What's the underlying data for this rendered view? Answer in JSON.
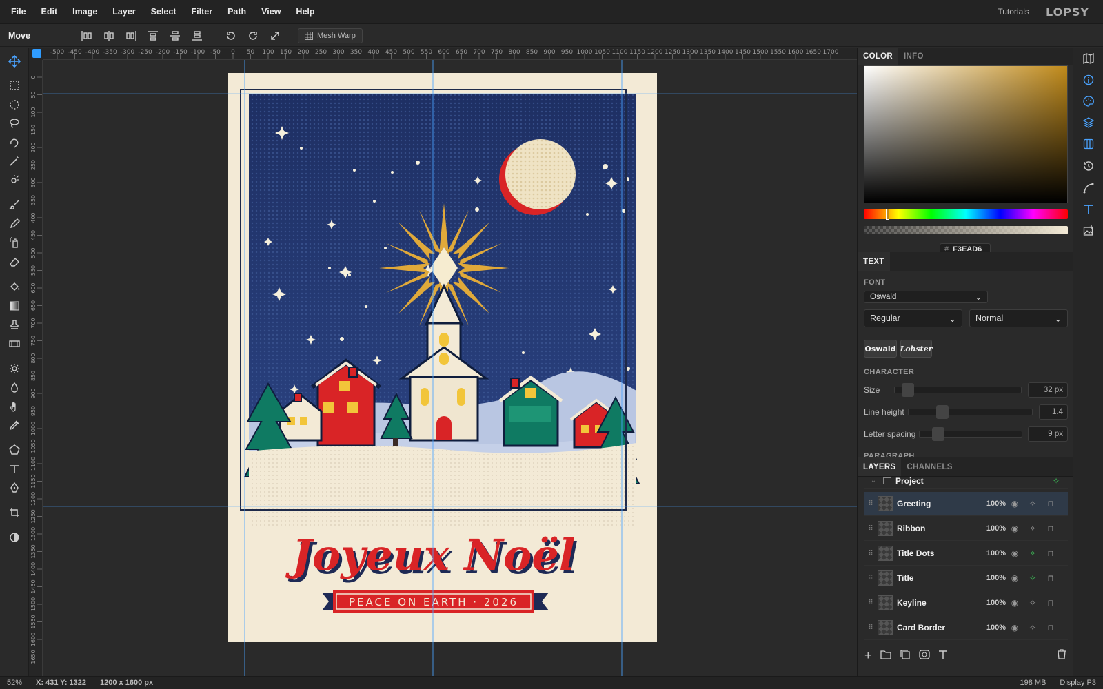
{
  "menu": [
    "File",
    "Edit",
    "Image",
    "Layer",
    "Select",
    "Filter",
    "Path",
    "View",
    "Help"
  ],
  "menu_right": {
    "tutorials": "Tutorials",
    "logo": "LOPSY"
  },
  "options": {
    "tool_name": "Move",
    "mesh_warp": "Mesh Warp"
  },
  "ruler_h": [
    "-500",
    "-450",
    "-400",
    "-350",
    "-300",
    "-250",
    "-200",
    "-150",
    "-100",
    "-50",
    "0",
    "50",
    "100",
    "150",
    "200",
    "250",
    "300",
    "350",
    "400",
    "450",
    "500",
    "550",
    "600",
    "650",
    "700",
    "750",
    "800",
    "850",
    "900",
    "950",
    "1000",
    "1050",
    "1100",
    "1150",
    "1200",
    "1250",
    "1300",
    "1350",
    "1400",
    "1450",
    "1500",
    "1550",
    "1600",
    "1650",
    "1700"
  ],
  "ruler_v": [
    "0",
    "50",
    "100",
    "150",
    "200",
    "250",
    "300",
    "350",
    "400",
    "450",
    "500",
    "550",
    "600",
    "650",
    "700",
    "750",
    "800",
    "850",
    "900",
    "950",
    "1000",
    "1050",
    "1100",
    "1150",
    "1200",
    "1250",
    "1300",
    "1350",
    "1400",
    "1450",
    "1500",
    "1550",
    "1600",
    "1650"
  ],
  "card": {
    "title": "Joyeux Noël",
    "ribbon": "PEACE ON EARTH · 2026"
  },
  "color_panel": {
    "tabs": [
      "COLOR",
      "INFO"
    ],
    "hex_symbol": "#",
    "hex": "F3EAD6",
    "accent": "#c08a1a"
  },
  "text_panel": {
    "tab": "TEXT",
    "font_label": "FONT",
    "font": "Oswald",
    "style": "Regular",
    "weight": "Normal",
    "presets": [
      "Oswald",
      "Lobster"
    ],
    "character_label": "CHARACTER",
    "size_label": "Size",
    "size": "32 px",
    "line_height_label": "Line height",
    "line_height": "1.4",
    "letter_spacing_label": "Letter spacing",
    "letter_spacing": "9 px",
    "paragraph_label": "PARAGRAPH"
  },
  "layers_panel": {
    "tabs": [
      "LAYERS",
      "CHANNELS"
    ],
    "group": "Project",
    "layers": [
      {
        "name": "Greeting",
        "opacity": "100%"
      },
      {
        "name": "Ribbon",
        "opacity": "100%"
      },
      {
        "name": "Title Dots",
        "opacity": "100%"
      },
      {
        "name": "Title",
        "opacity": "100%"
      },
      {
        "name": "Keyline",
        "opacity": "100%"
      },
      {
        "name": "Card Border",
        "opacity": "100%"
      }
    ]
  },
  "status": {
    "zoom": "52%",
    "coords_label": "X: 431 Y: 1322",
    "size": "1200 x 1600 px",
    "memory": "198 MB",
    "profile": "Display P3"
  }
}
